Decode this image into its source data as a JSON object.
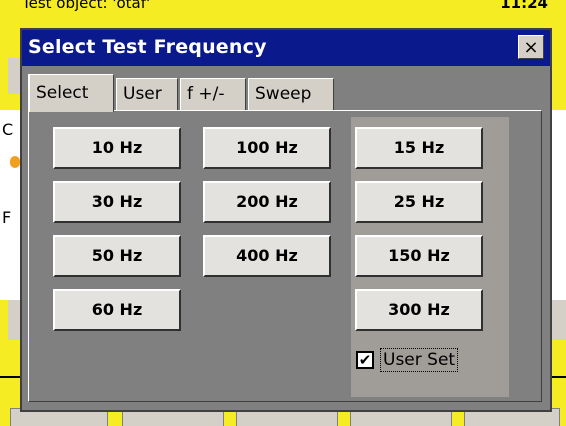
{
  "background": {
    "title": "Test object: 'otaf'",
    "clock": "11:24"
  },
  "dialog": {
    "title": "Select Test Frequency",
    "close_label": "×"
  },
  "tabs": [
    "Select",
    "User",
    "f +/-",
    "Sweep"
  ],
  "active_tab": "Select",
  "frequencies": {
    "column1": [
      "10 Hz",
      "30 Hz",
      "50 Hz",
      "60 Hz"
    ],
    "column2": [
      "100 Hz",
      "200 Hz",
      "400 Hz"
    ],
    "column3": [
      "15 Hz",
      "25 Hz",
      "150 Hz",
      "300 Hz"
    ]
  },
  "user_set": {
    "label": "User Set",
    "checked": true,
    "check_glyph": "✔"
  }
}
